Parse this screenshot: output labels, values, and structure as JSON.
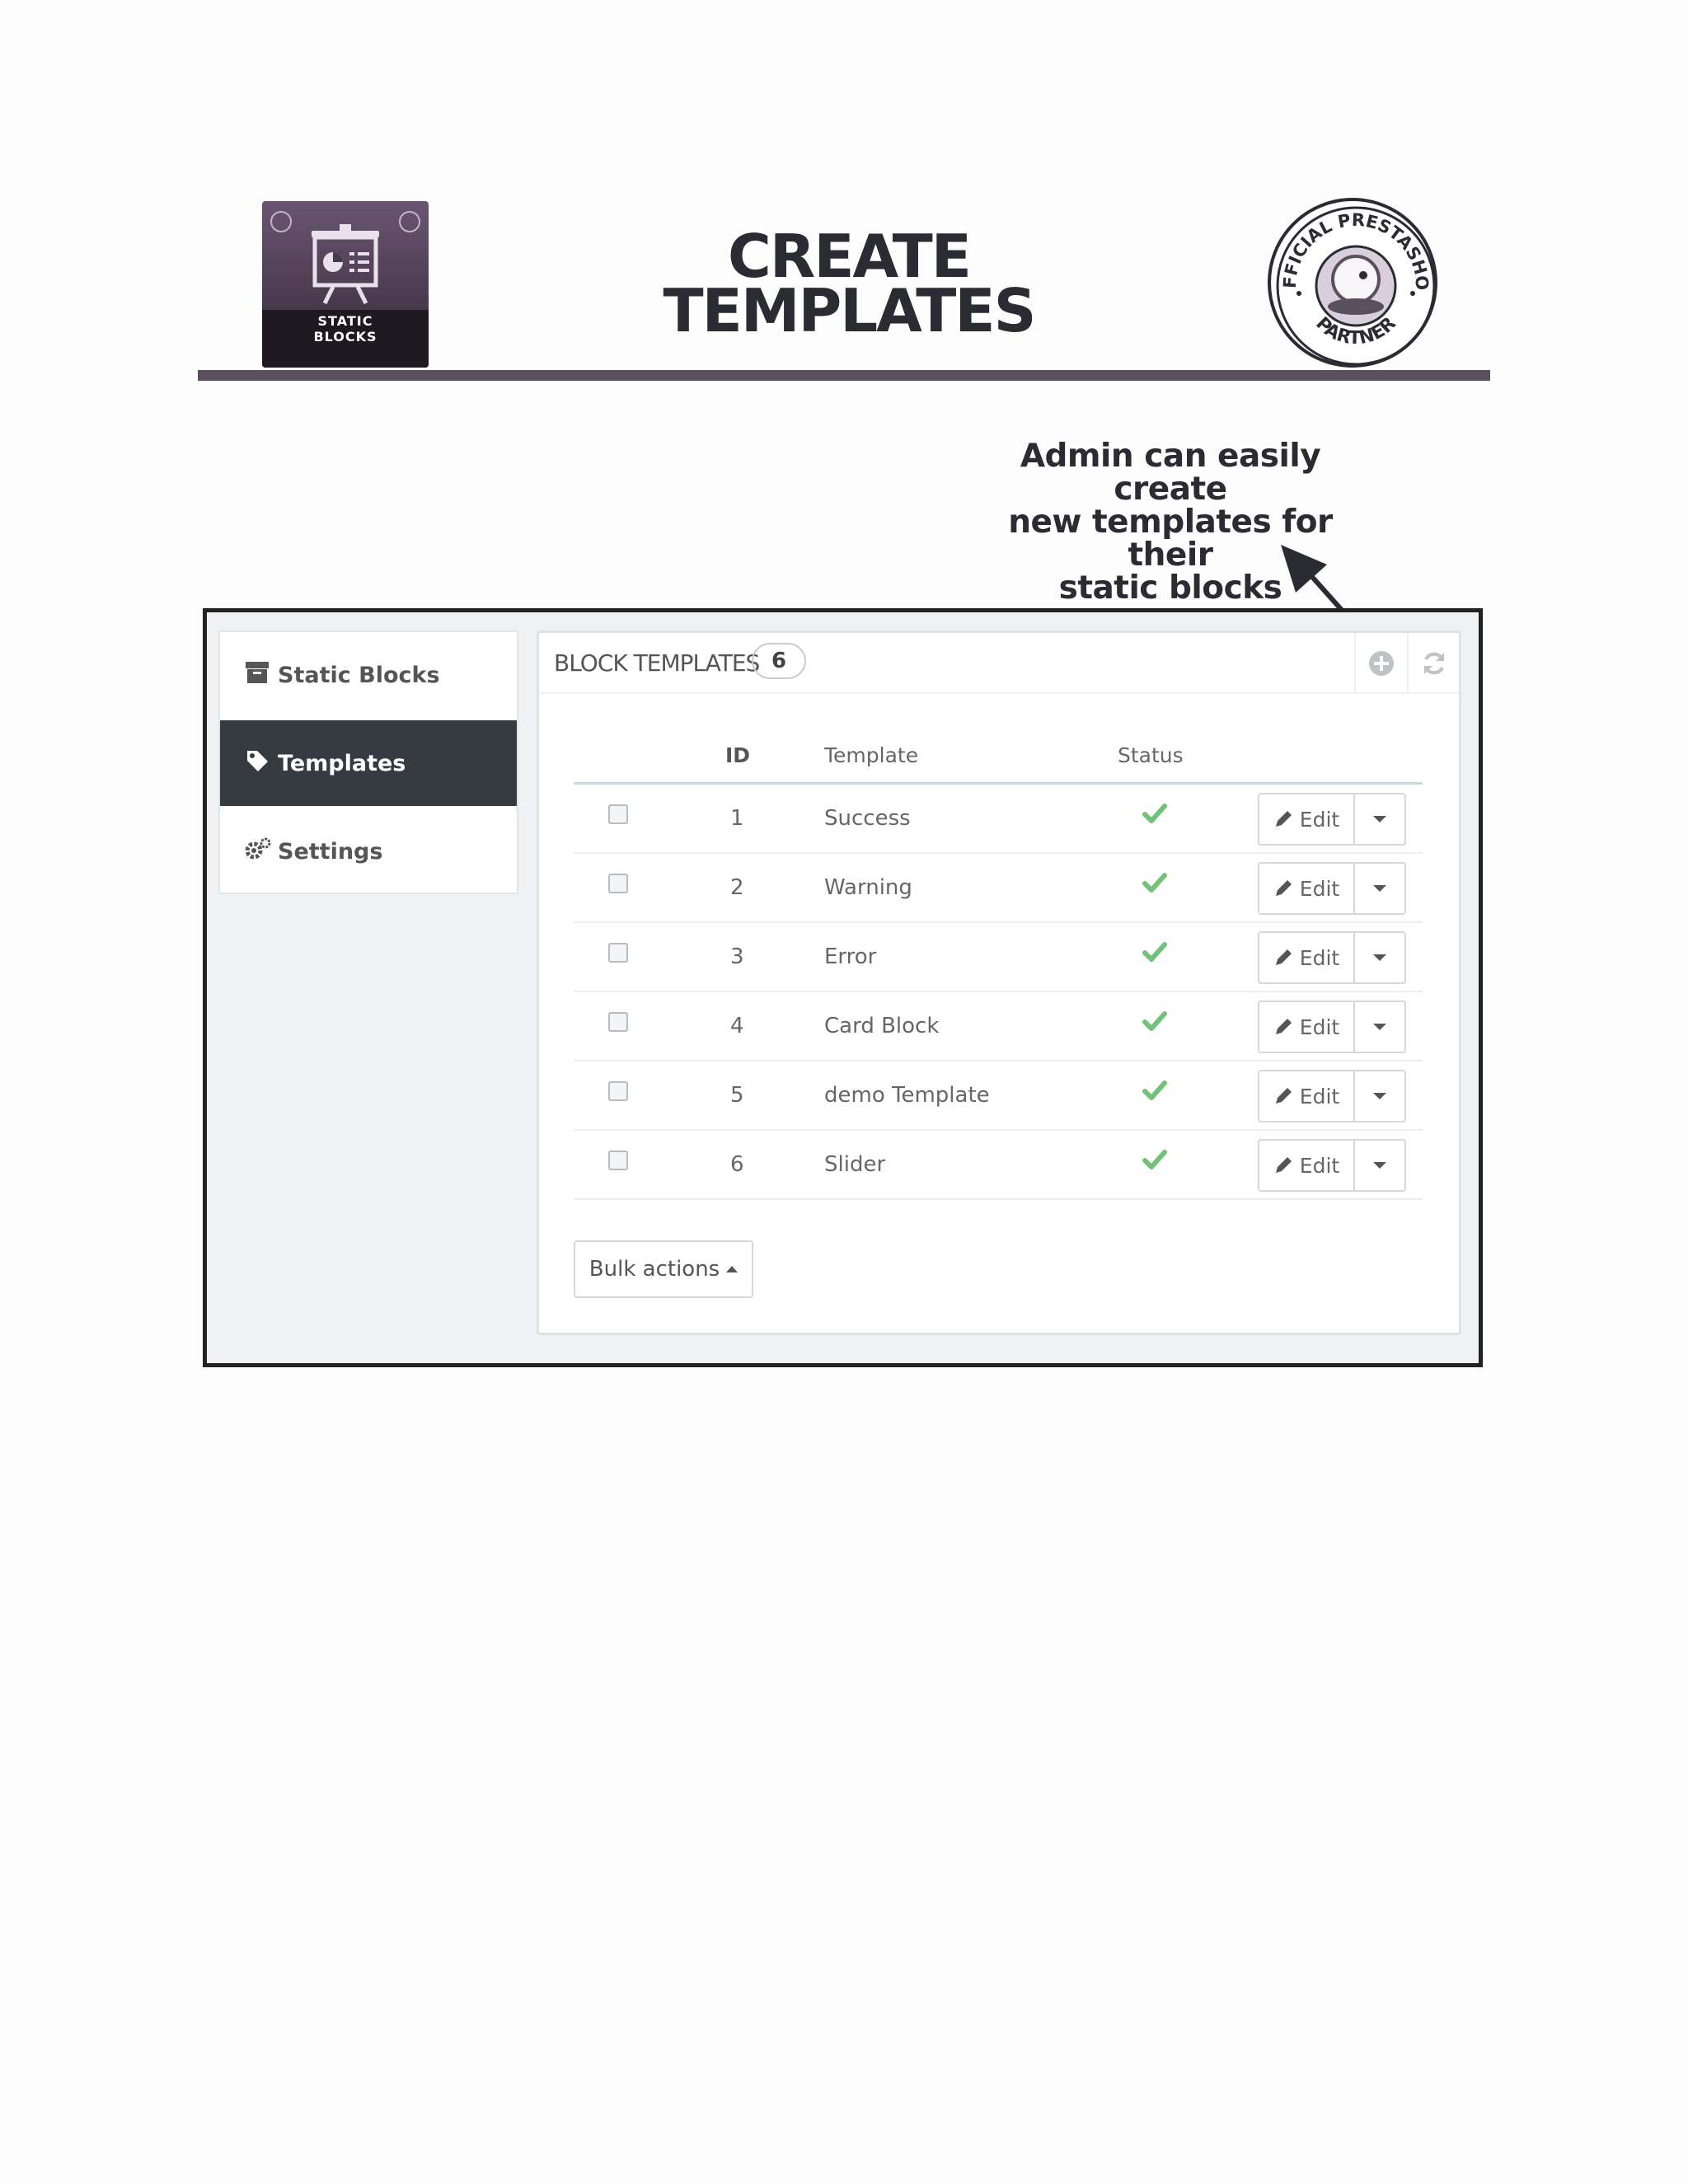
{
  "header": {
    "logo_text_line1": "STATIC",
    "logo_text_line2": "BLOCKS",
    "title_line1": "CREATE",
    "title_line2": "TEMPLATES",
    "badge_text_top": "OFFICIAL PRESTASHOP",
    "badge_text_bottom": "PARTNER"
  },
  "annotation": {
    "line1": "Admin can easily create",
    "line2": "new templates for their",
    "line3": "static blocks"
  },
  "sidebar": {
    "items": [
      {
        "label": "Static Blocks",
        "icon": "archive-icon",
        "active": false
      },
      {
        "label": "Templates",
        "icon": "tag-icon",
        "active": true
      },
      {
        "label": "Settings",
        "icon": "cogs-icon",
        "active": false
      }
    ]
  },
  "panel": {
    "title": "BLOCK TEMPLATES",
    "count": "6",
    "add_icon": "add-circle-icon",
    "refresh_icon": "refresh-icon",
    "columns": {
      "id": "ID",
      "template": "Template",
      "status": "Status"
    },
    "rows": [
      {
        "id": "1",
        "template": "Success",
        "status": "enabled",
        "edit_label": "Edit"
      },
      {
        "id": "2",
        "template": "Warning",
        "status": "enabled",
        "edit_label": "Edit"
      },
      {
        "id": "3",
        "template": "Error",
        "status": "enabled",
        "edit_label": "Edit"
      },
      {
        "id": "4",
        "template": "Card Block",
        "status": "enabled",
        "edit_label": "Edit"
      },
      {
        "id": "5",
        "template": "demo Template",
        "status": "enabled",
        "edit_label": "Edit"
      },
      {
        "id": "6",
        "template": "Slider",
        "status": "enabled",
        "edit_label": "Edit"
      }
    ],
    "bulk_actions_label": "Bulk actions"
  },
  "colors": {
    "accent_dark": "#363a41",
    "status_enabled": "#72c279",
    "brand_purple": "#5a4f5d"
  }
}
